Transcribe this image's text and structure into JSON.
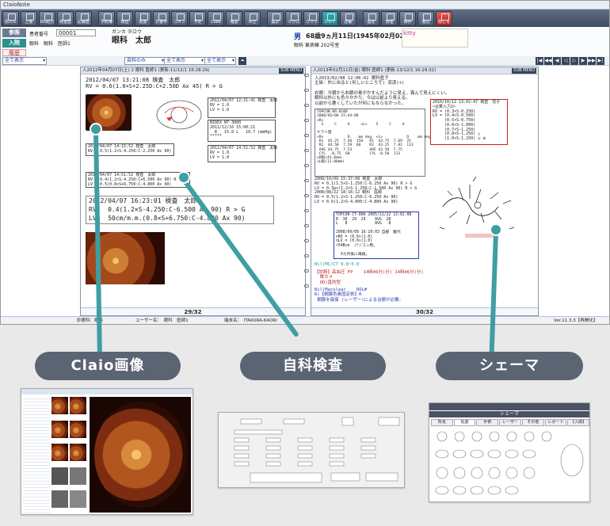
{
  "app": {
    "title": "ClaioNote",
    "toolbar": [
      {
        "label": "前カルテ",
        "icon": "prev-chart-icon"
      },
      {
        "label": "上書",
        "icon": "overwrite-icon"
      },
      {
        "label": "DO処方",
        "icon": "do-icon"
      },
      {
        "label": "検査歴",
        "icon": "exam-history-icon"
      },
      {
        "label": "記載歴",
        "icon": "record-history-icon"
      },
      {
        "label": "予約簿",
        "icon": "reservation-icon"
      },
      {
        "label": "検査",
        "icon": "exam-icon"
      },
      {
        "label": "処置",
        "icon": "treatment-icon"
      },
      {
        "label": "文書作成",
        "icon": "document-icon"
      },
      {
        "label": "コメント",
        "icon": "comment-icon"
      },
      {
        "label": "予定",
        "icon": "schedule-icon"
      },
      {
        "label": "Claio",
        "icon": "claio-icon"
      },
      {
        "label": "確認",
        "icon": "confirm-icon"
      },
      {
        "label": "中止",
        "icon": "stop-icon"
      },
      {
        "label": "集計",
        "icon": "summary-icon"
      },
      {
        "label": "マクロ",
        "icon": "macro-icon"
      },
      {
        "label": "クリップ",
        "icon": "clip-icon"
      },
      {
        "label": "カルテ",
        "icon": "chart-icon"
      },
      {
        "label": "記載",
        "icon": "write-icon"
      },
      {
        "label": "設定",
        "icon": "gear-icon"
      },
      {
        "label": "管理",
        "icon": "admin-icon"
      },
      {
        "label": "保存",
        "icon": "save-icon"
      },
      {
        "label": "書込",
        "icon": "write2-icon"
      },
      {
        "label": "閉じる",
        "icon": "close-icon"
      }
    ]
  },
  "patient": {
    "tag_ref": "参照",
    "tag_in": "入院",
    "tag_hist": "履歴",
    "id_label": "患者番号",
    "id": "00001",
    "kana": "ガンカ タロウ",
    "name": "眼科　太郎",
    "dept_line": "眼科　眼科　医師1",
    "sex": "男",
    "age": "68歳9ヵ月11日(1945年02月02日生)",
    "address": "眼科 東病棟 202号室",
    "memo": "kitty"
  },
  "filters": {
    "f1": "全て表示",
    "f2": "自科のみ",
    "f3": "全て表示",
    "f4": "全て表示"
  },
  "left_page": {
    "header": "入2012年04月07日(土) 2 眼科 医師1 (更新:11/12/1 16:28:29)",
    "submenu": "SUB MENU",
    "sec1_title": "2012/04/07 13:21:08 検査　太郎",
    "sec1_text": "RV = 0.6(1.0×S+2.25D:C+2.50D Ax 45) R = G",
    "box1_text": "2012/04/07 12:21:41 検査　太郎\nRV = 1.0\nLV = 1.0",
    "box2_text": "NIDEX NT-3000\n2011/12/16 15:00:21\n  R   15.0 L   10.7 (mmHg)\n*****",
    "box3_text": "2012/04/07 14:51:52 検査　太郎\nRV = 1.0\nLV = 1.0",
    "box4_text": "2012/04/07 14:15:52 検査　太郎\nRV = 0.5(1.2×S-4.250:C-2.250 Ax 90)",
    "box5_text": "2012/04/07 14:51:52 検査　太郎\nRV = 0.4(1.2×S-4.250:C+6.500 Ax 90) R > G\nLV = 0.5(0.8×S+6.750:C-4.800 Ax 90)",
    "big_title": "2012/04/07 16:23:01 検査　太郎",
    "big_rv": "RV   0.4(1.2×S-4.250:C-6.500 Ax 90) R > G",
    "big_lv": "LV   50cm/m.m.(0.8×S+6.750:C-4.800 Ax 90)",
    "footer": "29/32"
  },
  "right_page": {
    "header": "入2013年02月11日(金) 眼科 医師1 (更新:13/12/1 16:29:32)",
    "submenu": "SUB MENU",
    "note": "入2013/02/08 12:06:42 眼科医子\n主訴：外に出ると(何しいところで) 流涙(+)\n\n右眼：今朝から右眼の奥がかすんだように見え、霧んで見えにくい。\n眼科以外にも色々かかり、今は以前より見える。\n以前から悪くしていたが何にもならなかった。",
    "topcon_text": "TOPCON KR-8100\n2008/02/06 15:44:08\n<R>\n  S     C     A     <L>    S     C     A\n\nケラト値\n<R>           D    mm deg  <L>           D    mm deg\n R1  45.25  7.46  150   R1  43.75  7.69  25\n R2  44.50  7.59  60    R2  43.25  7.81  113\n AVE 44.75  7.53        AVE 43.50  7.75\n CYL  -0.75  60         CYL -0.50  113\n○R眼(43.0mm)\n○L眼(12.00mm)",
    "red_box": "2010/10/12 13:02:47 検査　花子\n<合算入力2>\nRV = (0.3×S-0.250)\nLV = (0.4×S-0.500)\n     (0.5×S-0.750)\n     (0.6×S-1.000)\n     (0.7×S-1.250)\n     (0.8×S-1.250) △\n     (1.0×S-1.250) ◎ ※",
    "mid_text": "2008/10/09 15:37:08 検査　太郎\nRV = 0.1(1.5×S-1.250:C-6.250 Ax 90) R > G\nLV = 0.3p×(1.2×S-1.250:C-1.500 Ax 90) R > G\n2008/08/22 18:16:12 眼科　医師\nRV = 0.5(1.2×S-1.250:C-6.250 Ax 90)\nLV = 0.6(1.2×S-4.000:C-4.800 Ax 90)",
    "blue_box": "TOPCON CT-80A 2005/11/22 13:02:08\nR  30  29  29    AVG  28\nL   8            AVG   8\n\n2008/09/09 16:10:03 自部　雅代\nnRV = (0.6×(1.0)\nnLV = (0.6×(1.0)\nr54Bcm  パソコン用。\n\n  3カ月後に再検。",
    "teal_line": "Bil)MC/CT 0.8~5.0",
    "bottom_text": "【診断】高血圧 FP    14時46分(分) 14時46分(分)\n  眼カメ\n  OD)直的型",
    "teal_bottom": "Bil)Maculear    ROL#\nR)【網膜色素固定術】R\n 網膜を瘢痕 (レーザー)による治療が必要。",
    "footer": "30/32"
  },
  "statusbar": {
    "dept": "診療科：眼科",
    "user": "ユーザー名：　眼科　医師1",
    "terminal": "端末名：　ITAKURA-KAORI",
    "version": "Ver.11.3.3【再開化】"
  },
  "callouts": {
    "claio": "Claio画像",
    "jika": "自科検査",
    "schema": "シェーマ"
  },
  "thumb_schema": {
    "tabs": [
      "所見",
      "処置",
      "手術",
      "レーザー",
      "その他",
      "レポート",
      "【入院】"
    ],
    "title": "シェーマ"
  },
  "colors": {
    "teal": "#3f9ea3",
    "pill": "#5b6473",
    "toolbar": "#4e5c73"
  }
}
